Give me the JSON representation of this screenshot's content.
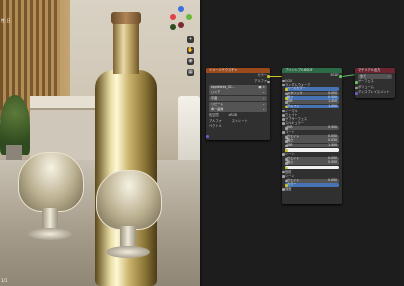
{
  "viewport": {
    "top_label": "性 日",
    "bottom_label": "1/1"
  },
  "colors": {
    "accent_blue": "#4772b3",
    "header_orange": "#9b4a1b",
    "header_green": "#2b6c47",
    "header_red": "#6e2532",
    "socket_yellow": "#c7c729",
    "socket_green": "#63c763"
  },
  "texture_node": {
    "title": "イメージテクスチャ",
    "out_color": "カラー",
    "out_alpha": "アルファ",
    "image_name": "applebres_02...",
    "rows": [
      {
        "label": "リニア",
        "value": ""
      },
      {
        "label": "平面",
        "value": ""
      },
      {
        "label": "リピート",
        "value": ""
      },
      {
        "label": "単一画像",
        "value": ""
      },
      {
        "label": "色空間",
        "value": "sRGB"
      },
      {
        "label": "アルファ",
        "value": "ストレート"
      }
    ],
    "vector_label": "ベクトル"
  },
  "bsdf_node": {
    "title": "プリンシプルBSDF",
    "out_label": "BSDF",
    "rows": [
      {
        "label": "GGX",
        "value": "",
        "style": "plain"
      },
      {
        "label": "ランダムウォーク",
        "value": "",
        "style": "plain"
      },
      {
        "label": "ベースカラー",
        "value": "",
        "style": "blue"
      },
      {
        "label": "メタリック",
        "value": "0.000",
        "style": "field"
      },
      {
        "label": "粗さ",
        "value": "0.500",
        "style": "blue"
      },
      {
        "label": "IOR",
        "value": "1.450",
        "style": "field"
      },
      {
        "label": "アルファ",
        "value": "1.000",
        "style": "blue"
      },
      {
        "label": "ノーマル",
        "value": "",
        "style": "plain"
      },
      {
        "label": "ウェイト",
        "value": "",
        "style": "plain"
      },
      {
        "label": "サブサーフェス",
        "value": "",
        "style": "plain"
      },
      {
        "label": "スペキュラー",
        "value": "",
        "style": "plain"
      },
      {
        "label": "IOR",
        "value": "0.500",
        "style": "field"
      },
      {
        "label": "コート",
        "value": "",
        "style": "plain"
      },
      {
        "label": "ウェイト",
        "value": "0.000",
        "style": "field"
      },
      {
        "label": "粗さ",
        "value": "0.030",
        "style": "field"
      },
      {
        "label": "IOR",
        "value": "1.500",
        "style": "field"
      },
      {
        "label": "色彩",
        "value": "",
        "style": "white"
      },
      {
        "label": "シーン",
        "value": "",
        "style": "plain"
      },
      {
        "label": "ウェイト",
        "value": "0.000",
        "style": "field"
      },
      {
        "label": "粗さ",
        "value": "0.500",
        "style": "field"
      },
      {
        "label": "色彩",
        "value": "",
        "style": "white"
      },
      {
        "label": "放射",
        "value": "",
        "style": "plain"
      },
      {
        "label": "シーン",
        "value": "",
        "style": "plain"
      },
      {
        "label": "ウェイト",
        "value": "0.000",
        "style": "field"
      },
      {
        "label": "カラー",
        "value": "",
        "style": "blue"
      },
      {
        "label": "強度",
        "value": "",
        "style": "plain"
      }
    ]
  },
  "output_node": {
    "title": "マテリアル出力",
    "dropdown": "全て",
    "rows": [
      "サーフェス",
      "ボリューム",
      "ディスプレイスメント"
    ]
  }
}
